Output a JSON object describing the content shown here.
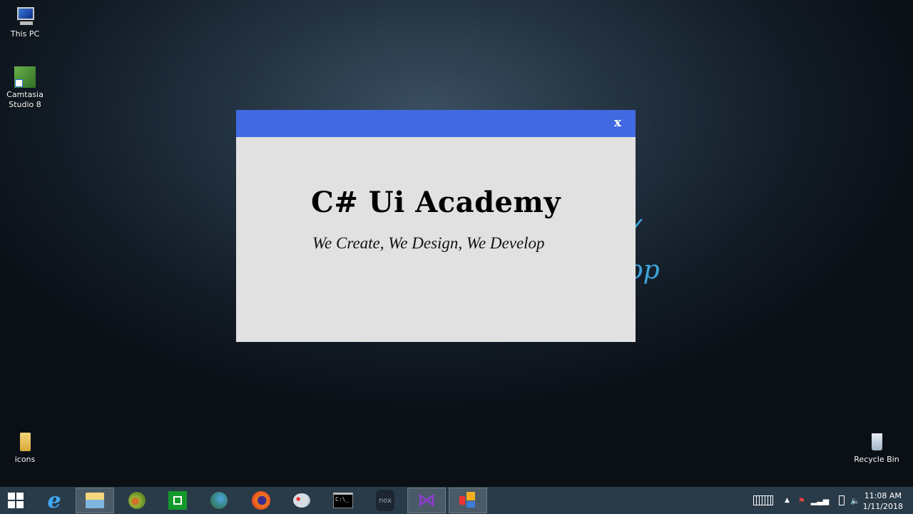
{
  "wallpaper": {
    "text_fragment": "op"
  },
  "desktop_icons": [
    {
      "label": "This PC",
      "icon": "computer-icon"
    },
    {
      "label": "Camtasia Studio 8",
      "icon": "camtasia-icon"
    },
    {
      "label": "icons",
      "icon": "folder-icon"
    },
    {
      "label": "Recycle Bin",
      "icon": "recycle-bin-icon"
    }
  ],
  "dialog": {
    "close_label": "x",
    "title": "C# Ui Academy",
    "subtitle": "We Create, We Design, We Develop",
    "titlebar_color": "#4169e1",
    "body_color": "#e1e1e1"
  },
  "taskbar": {
    "apps": [
      {
        "name": "start",
        "icon": "windows-icon"
      },
      {
        "name": "internet-explorer",
        "icon": "ie-icon"
      },
      {
        "name": "file-explorer",
        "icon": "folder-icon",
        "active": true
      },
      {
        "name": "chameleon",
        "icon": "chameleon-icon"
      },
      {
        "name": "store",
        "icon": "store-icon"
      },
      {
        "name": "internet-download-manager",
        "icon": "idm-icon"
      },
      {
        "name": "firefox",
        "icon": "firefox-icon"
      },
      {
        "name": "paint",
        "icon": "palette-icon"
      },
      {
        "name": "command-prompt",
        "icon": "cmd-icon"
      },
      {
        "name": "nox",
        "icon": "nox-icon"
      },
      {
        "name": "visual-studio",
        "icon": "visual-studio-icon",
        "active": true
      },
      {
        "name": "winforms-app",
        "icon": "app-icon",
        "active": true
      }
    ],
    "cmd_glyph": "C:\\_",
    "nox_label": "nox",
    "time": "11:08 AM",
    "date": "1/11/2018"
  }
}
